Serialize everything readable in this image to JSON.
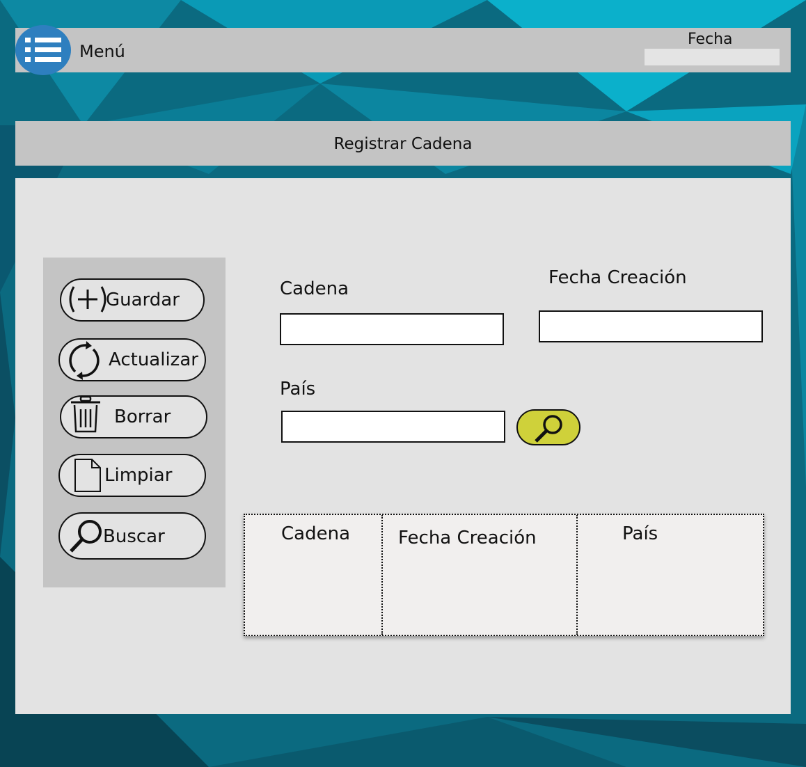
{
  "header": {
    "menu_label": "Menú",
    "menu_icon": "list-menu-icon",
    "fecha_label": "Fecha",
    "fecha_value": ""
  },
  "title": "Registrar Cadena",
  "actions": [
    {
      "label": "Guardar",
      "icon": "plus-circle-icon"
    },
    {
      "label": "Actualizar",
      "icon": "refresh-icon"
    },
    {
      "label": "Borrar",
      "icon": "trash-icon"
    },
    {
      "label": "Limpiar",
      "icon": "document-icon"
    },
    {
      "label": "Buscar",
      "icon": "magnifier-icon"
    }
  ],
  "form": {
    "cadena_label": "Cadena",
    "cadena_value": "",
    "fecha_creacion_label": "Fecha Creación",
    "fecha_creacion_value": "",
    "pais_label": "País",
    "pais_value": "",
    "search_icon": "magnifier-icon"
  },
  "table": {
    "columns": [
      "Cadena",
      "Fecha Creación",
      "País"
    ],
    "rows": []
  },
  "colors": {
    "background": "#0a5f74",
    "bars": "#c4c4c4",
    "panel": "#e3e3e3",
    "menu_button": "#2e7fbf",
    "search_button": "#cfd13a",
    "table": "#f1efee"
  }
}
